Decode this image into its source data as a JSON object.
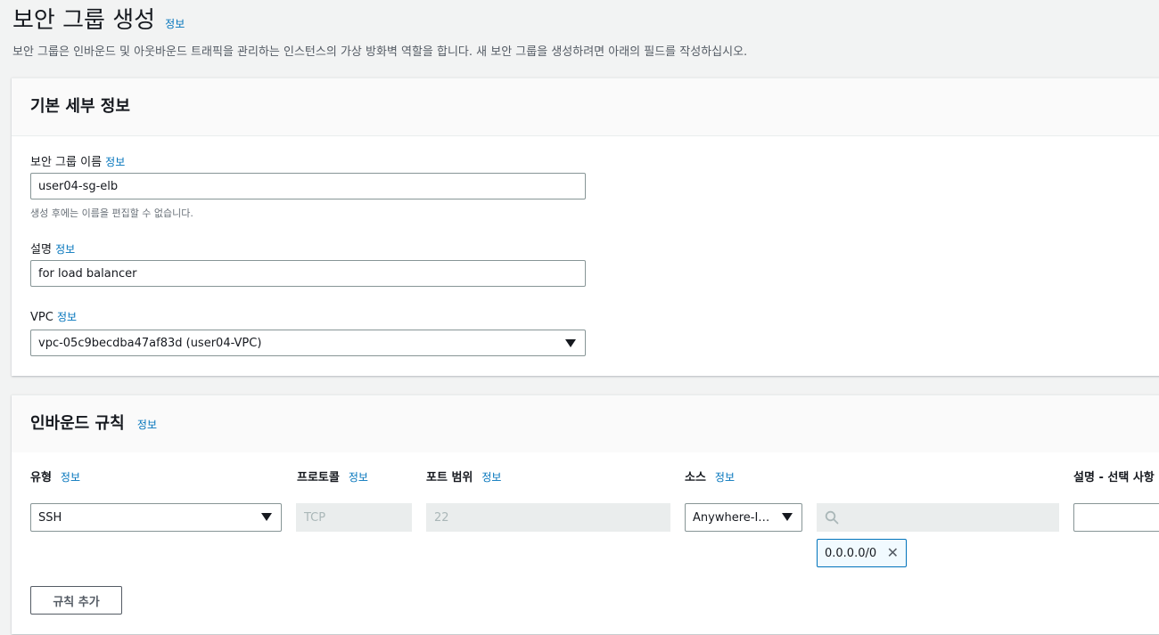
{
  "page": {
    "title": "보안 그룹 생성",
    "title_info": "정보",
    "description": "보안 그룹은 인바운드 및 아웃바운드 트래픽을 관리하는 인스턴스의 가상 방화벽 역할을 합니다. 새 보안 그룹을 생성하려면 아래의 필드를 작성하십시오."
  },
  "basic": {
    "title": "기본 세부 정보",
    "name_label": "보안 그룹 이름",
    "name_info": "정보",
    "name_value": "user04-sg-elb",
    "name_hint": "생성 후에는 이름을 편집할 수 없습니다.",
    "desc_label": "설명",
    "desc_info": "정보",
    "desc_value": "for load balancer",
    "vpc_label": "VPC",
    "vpc_info": "정보",
    "vpc_value": "vpc-05c9becdba47af83d (user04-VPC)"
  },
  "inbound": {
    "title": "인바운드 규칙",
    "title_info": "정보",
    "columns": {
      "type": "유형",
      "protocol": "프로토콜",
      "port_range": "포트 범위",
      "source": "소스",
      "description": "설명 - 선택 사항",
      "info": "정보"
    },
    "row": {
      "type": "SSH",
      "protocol": "TCP",
      "port": "22",
      "source_type": "Anywhere-I…",
      "source_search": "",
      "cidr": "0.0.0.0/0",
      "description": ""
    },
    "add_rule": "규칙 추가"
  },
  "colors": {
    "link": "#0073bb",
    "primary_text": "#16191f",
    "background": "#f2f3f3"
  },
  "icons": {
    "search": "search-icon",
    "close": "close-icon",
    "dropdown": "caret-down-icon"
  }
}
